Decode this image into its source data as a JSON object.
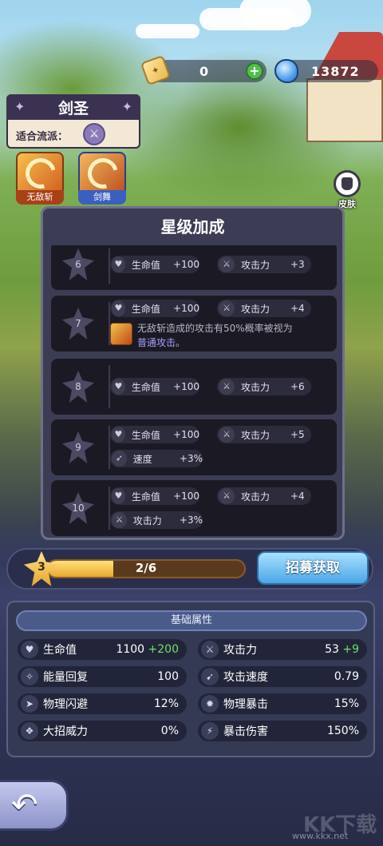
{
  "currency": {
    "ticket_value": "0",
    "gem_value": "13872",
    "plus_label": "+"
  },
  "character": {
    "name": "剑圣",
    "style_label": "适合流派："
  },
  "skills": [
    {
      "label": "无敌斩"
    },
    {
      "label": "剑舞"
    }
  ],
  "skin": {
    "label": "皮肤"
  },
  "star_panel": {
    "title": "星级加成",
    "tiers": [
      {
        "num": "6",
        "stats": [
          {
            "icon": "heart-icon",
            "label": "生命值",
            "value": "+100"
          },
          {
            "icon": "sword-icon",
            "label": "攻击力",
            "value": "+3"
          }
        ]
      },
      {
        "num": "7",
        "stats": [
          {
            "icon": "heart-icon",
            "label": "生命值",
            "value": "+100"
          },
          {
            "icon": "sword-icon",
            "label": "攻击力",
            "value": "+4"
          }
        ],
        "desc_text": "无敌斩造成的攻击有50%概率被视为",
        "desc_highlight": "普通攻击",
        "desc_end": "。"
      },
      {
        "num": "8",
        "stats": [
          {
            "icon": "heart-icon",
            "label": "生命值",
            "value": "+100"
          },
          {
            "icon": "sword-icon",
            "label": "攻击力",
            "value": "+6"
          }
        ]
      },
      {
        "num": "9",
        "stats": [
          {
            "icon": "heart-icon",
            "label": "生命值",
            "value": "+100"
          },
          {
            "icon": "sword-icon",
            "label": "攻击力",
            "value": "+5"
          },
          {
            "icon": "speed-icon",
            "label": "速度",
            "value": "+3%"
          }
        ]
      },
      {
        "num": "10",
        "stats": [
          {
            "icon": "heart-icon",
            "label": "生命值",
            "value": "+100"
          },
          {
            "icon": "sword-icon",
            "label": "攻击力",
            "value": "+4"
          },
          {
            "icon": "sword-icon",
            "label": "攻击力",
            "value": "+3%"
          }
        ]
      }
    ]
  },
  "progress": {
    "level": "3",
    "text": "2/6",
    "fraction": 0.333,
    "recruit_label": "招募获取"
  },
  "attributes": {
    "title": "基础属性",
    "items": [
      {
        "icon": "heart-icon",
        "name": "生命值",
        "value": "1100",
        "bonus": "+200"
      },
      {
        "icon": "sword-icon",
        "name": "攻击力",
        "value": "53",
        "bonus": "+9"
      },
      {
        "icon": "energy-icon",
        "name": "能量回复",
        "value": "100",
        "bonus": ""
      },
      {
        "icon": "attack-speed-icon",
        "name": "攻击速度",
        "value": "0.79",
        "bonus": ""
      },
      {
        "icon": "dodge-icon",
        "name": "物理闪避",
        "value": "12%",
        "bonus": ""
      },
      {
        "icon": "crit-icon",
        "name": "物理暴击",
        "value": "15%",
        "bonus": ""
      },
      {
        "icon": "ultimate-icon",
        "name": "大招威力",
        "value": "0%",
        "bonus": ""
      },
      {
        "icon": "crit-damage-icon",
        "name": "暴击伤害",
        "value": "150%",
        "bonus": ""
      }
    ]
  },
  "watermark": "www.kkx.net",
  "watermark_brand": "KK下载"
}
